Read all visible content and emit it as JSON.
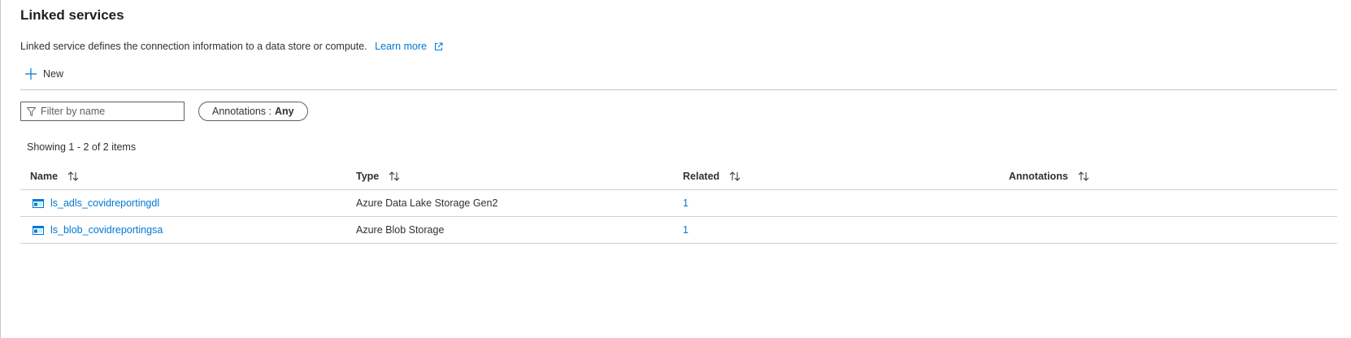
{
  "header": {
    "title": "Linked services",
    "description": "Linked service defines the connection information to a data store or compute.",
    "learn_more": "Learn more"
  },
  "toolbar": {
    "new_label": "New"
  },
  "filter": {
    "placeholder": "Filter by name",
    "annotations_label": "Annotations :",
    "annotations_value": "Any"
  },
  "summary": {
    "showing": "Showing 1 - 2 of 2 items"
  },
  "table": {
    "columns": [
      "Name",
      "Type",
      "Related",
      "Annotations"
    ],
    "rows": [
      {
        "name": "ls_adls_covidreportingdl",
        "type": "Azure Data Lake Storage Gen2",
        "related": "1",
        "annotations": ""
      },
      {
        "name": "ls_blob_covidreportingsa",
        "type": "Azure Blob Storage",
        "related": "1",
        "annotations": ""
      }
    ]
  },
  "icons": {
    "new": "plus-icon",
    "filter": "filter-icon",
    "external": "external-link-icon",
    "sort": "sort-icon",
    "linked_service": "linked-service-icon"
  },
  "colors": {
    "accent": "#0078d4",
    "text": "#323130",
    "divider": "#c8c6c4"
  }
}
